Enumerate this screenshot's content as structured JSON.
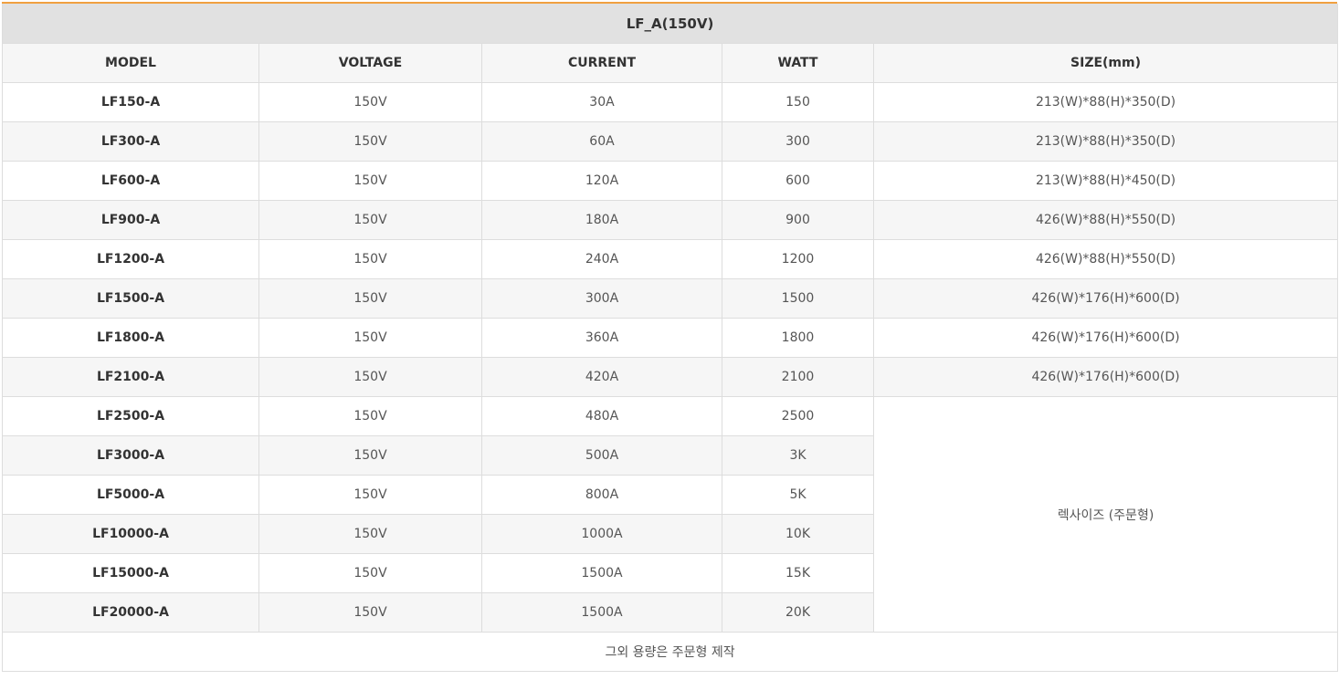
{
  "table": {
    "title": "LF_A(150V)",
    "headers": {
      "model": "MODEL",
      "voltage": "VOLTAGE",
      "current": "CURRENT",
      "watt": "WATT",
      "size": "SIZE(mm)"
    },
    "rows": [
      {
        "model": "LF150-A",
        "voltage": "150V",
        "current": "30A",
        "watt": "150",
        "size": "213(W)*88(H)*350(D)"
      },
      {
        "model": "LF300-A",
        "voltage": "150V",
        "current": "60A",
        "watt": "300",
        "size": "213(W)*88(H)*350(D)"
      },
      {
        "model": "LF600-A",
        "voltage": "150V",
        "current": "120A",
        "watt": "600",
        "size": "213(W)*88(H)*450(D)"
      },
      {
        "model": "LF900-A",
        "voltage": "150V",
        "current": "180A",
        "watt": "900",
        "size": "426(W)*88(H)*550(D)"
      },
      {
        "model": "LF1200-A",
        "voltage": "150V",
        "current": "240A",
        "watt": "1200",
        "size": "426(W)*88(H)*550(D)"
      },
      {
        "model": "LF1500-A",
        "voltage": "150V",
        "current": "300A",
        "watt": "1500",
        "size": "426(W)*176(H)*600(D)"
      },
      {
        "model": "LF1800-A",
        "voltage": "150V",
        "current": "360A",
        "watt": "1800",
        "size": "426(W)*176(H)*600(D)"
      },
      {
        "model": "LF2100-A",
        "voltage": "150V",
        "current": "420A",
        "watt": "2100",
        "size": "426(W)*176(H)*600(D)"
      },
      {
        "model": "LF2500-A",
        "voltage": "150V",
        "current": "480A",
        "watt": "2500"
      },
      {
        "model": "LF3000-A",
        "voltage": "150V",
        "current": "500A",
        "watt": "3K"
      },
      {
        "model": "LF5000-A",
        "voltage": "150V",
        "current": "800A",
        "watt": "5K"
      },
      {
        "model": "LF10000-A",
        "voltage": "150V",
        "current": "1000A",
        "watt": "10K"
      },
      {
        "model": "LF15000-A",
        "voltage": "150V",
        "current": "1500A",
        "watt": "15K"
      },
      {
        "model": "LF20000-A",
        "voltage": "150V",
        "current": "1500A",
        "watt": "20K"
      }
    ],
    "merged_size_note": "렉사이즈 (주문형)",
    "footer_note": "그외 용량은 주문형 제작"
  },
  "colors": {
    "accent_top_line": "#f0a040",
    "title_bg": "#e1e1e1",
    "header_bg": "#f6f6f6",
    "stripe_bg": "#f6f6f6",
    "border": "#dddddd"
  }
}
